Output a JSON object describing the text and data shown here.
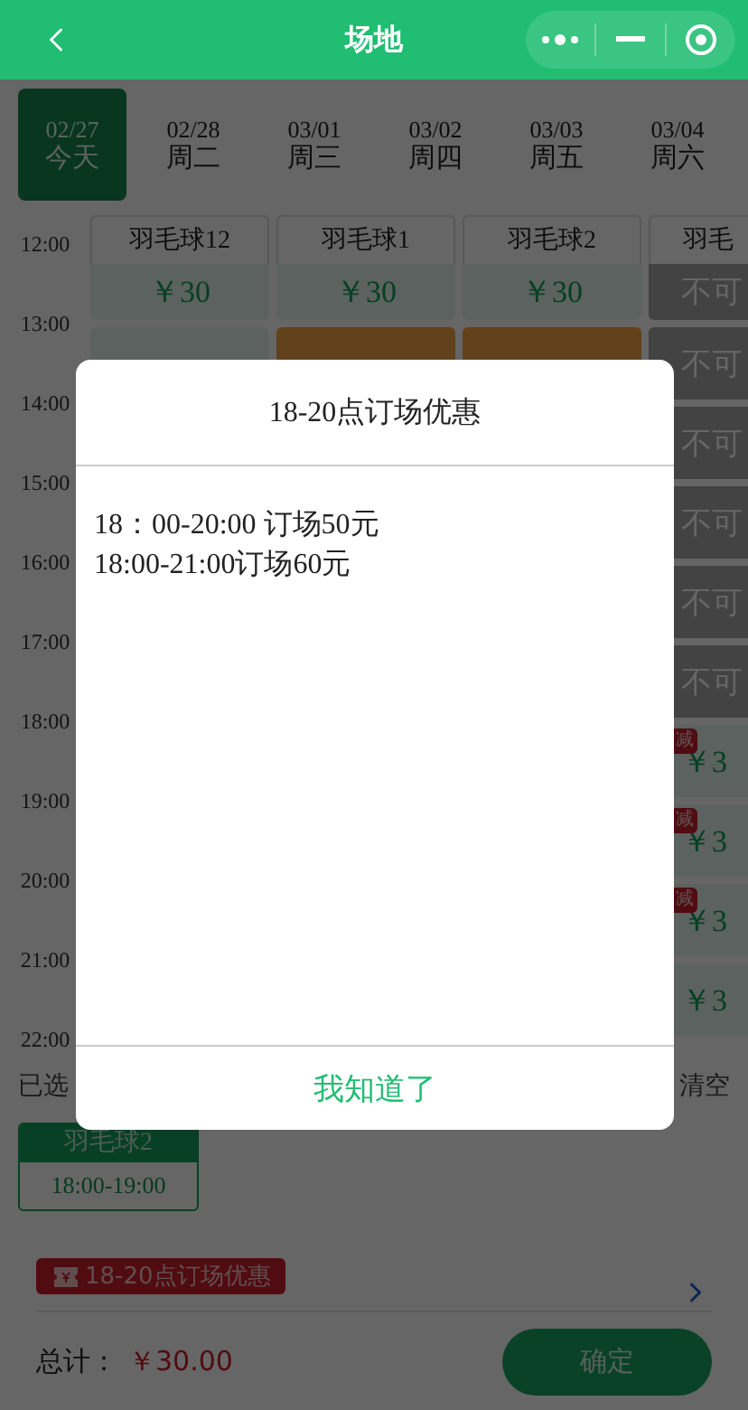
{
  "nav": {
    "title": "场地"
  },
  "dates": [
    {
      "date": "02/27",
      "day": "今天",
      "selected": true
    },
    {
      "date": "02/28",
      "day": "周二",
      "selected": false
    },
    {
      "date": "03/01",
      "day": "周三",
      "selected": false
    },
    {
      "date": "03/02",
      "day": "周四",
      "selected": false
    },
    {
      "date": "03/03",
      "day": "周五",
      "selected": false
    },
    {
      "date": "03/04",
      "day": "周六",
      "selected": false
    }
  ],
  "times": [
    "12:00",
    "13:00",
    "14:00",
    "15:00",
    "16:00",
    "17:00",
    "18:00",
    "19:00",
    "20:00",
    "21:00",
    "22:00"
  ],
  "courts": [
    {
      "name": "羽毛球12",
      "slots": [
        {
          "kind": "price",
          "text": "￥30"
        },
        {
          "kind": "price"
        }
      ]
    },
    {
      "name": "羽毛球1",
      "slots": [
        {
          "kind": "price",
          "text": "￥30"
        },
        {
          "kind": "booked"
        }
      ]
    },
    {
      "name": "羽毛球2",
      "slots": [
        {
          "kind": "price",
          "text": "￥30"
        },
        {
          "kind": "booked"
        }
      ]
    },
    {
      "name": "羽毛",
      "slots": [
        {
          "kind": "unavailable",
          "text": "不可"
        },
        {
          "kind": "unavailable",
          "text": "不可"
        },
        {
          "kind": "unavailable",
          "text": "不可"
        },
        {
          "kind": "unavailable",
          "text": "不可"
        },
        {
          "kind": "unavailable",
          "text": "不可"
        },
        {
          "kind": "unavailable",
          "text": "不可"
        },
        {
          "kind": "price",
          "text": "￥3",
          "tag": "减"
        },
        {
          "kind": "price",
          "text": "￥3",
          "tag": "减"
        },
        {
          "kind": "price",
          "text": "￥3",
          "tag": "减"
        },
        {
          "kind": "price",
          "text": "￥3"
        }
      ]
    }
  ],
  "selection": {
    "label": "已选",
    "clear": "清空",
    "items": [
      {
        "court": "羽毛球2",
        "time": "18:00-19:00"
      }
    ]
  },
  "promo": {
    "label": "18-20点订场优惠"
  },
  "total": {
    "label": "总计：",
    "amount": "￥30.00"
  },
  "confirm": "确定",
  "modal": {
    "title": "18-20点订场优惠",
    "lines": [
      "18：00-20:00 订场50元",
      "18:00-21:00订场60元"
    ],
    "button": "我知道了"
  }
}
